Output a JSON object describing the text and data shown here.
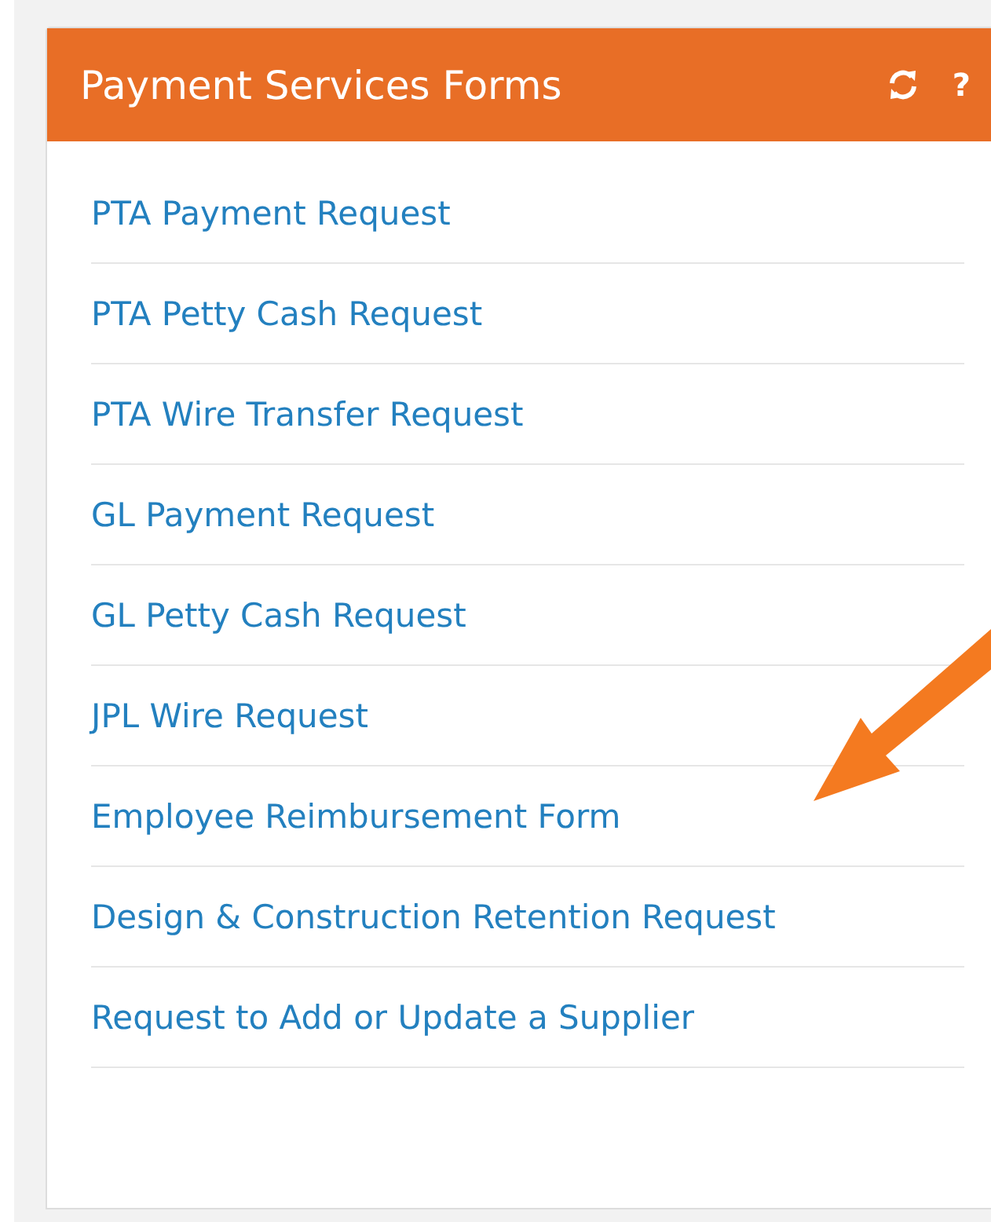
{
  "panel": {
    "title": "Payment Services Forms",
    "help": "?"
  },
  "links": [
    "PTA Payment Request",
    "PTA Petty Cash Request",
    "PTA Wire Transfer Request",
    "GL Payment Request",
    "GL Petty Cash Request",
    "JPL Wire Request",
    "Employee Reimbursement Form",
    "Design & Construction Retention Request",
    "Request to Add or Update a Supplier"
  ]
}
